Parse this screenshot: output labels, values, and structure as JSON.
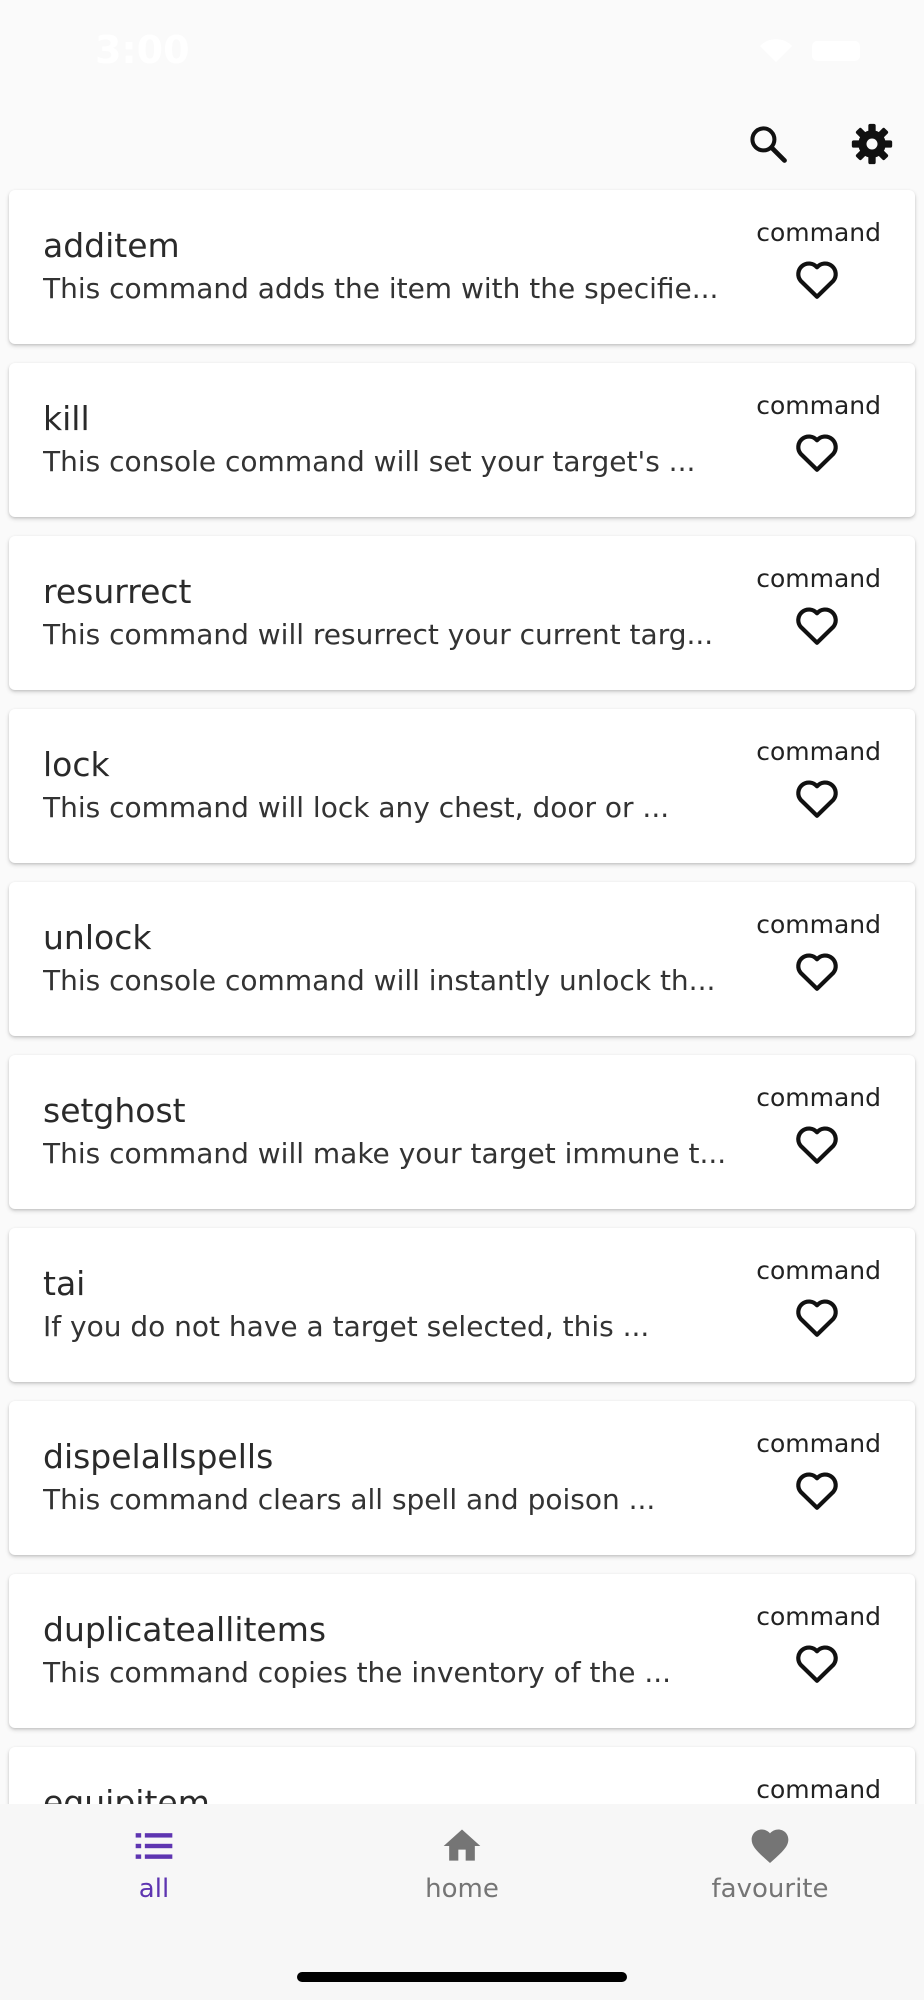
{
  "status_bar": {
    "time": "3:00",
    "wifi_icon": "wifi-icon",
    "battery_icon": "battery-icon"
  },
  "app_bar": {
    "search_icon": "search-icon",
    "settings_icon": "gear-icon"
  },
  "items": [
    {
      "title": "additem",
      "description": "This command adds the item with the specifie...",
      "type": "command"
    },
    {
      "title": "kill",
      "description": "This console command will set your target's ...",
      "type": "command"
    },
    {
      "title": "resurrect",
      "description": "This command will resurrect your current targ...",
      "type": "command"
    },
    {
      "title": "lock",
      "description": "This command will lock any chest, door or ...",
      "type": "command"
    },
    {
      "title": "unlock",
      "description": "This console command will instantly unlock th...",
      "type": "command"
    },
    {
      "title": "setghost",
      "description": "This command will make your target immune t...",
      "type": "command"
    },
    {
      "title": "tai",
      "description": "If you do not have a target selected, this ...",
      "type": "command"
    },
    {
      "title": "dispelallspells",
      "description": "This command clears all spell and poison ...",
      "type": "command"
    },
    {
      "title": "duplicateallitems",
      "description": "This command copies the inventory of the ...",
      "type": "command"
    },
    {
      "title": "equipitem",
      "description": "",
      "type": "command"
    }
  ],
  "bottom_nav": {
    "all_label": "all",
    "home_label": "home",
    "favourite_label": "favourite",
    "active_color": "#5e35b1",
    "inactive_color": "#757575"
  }
}
